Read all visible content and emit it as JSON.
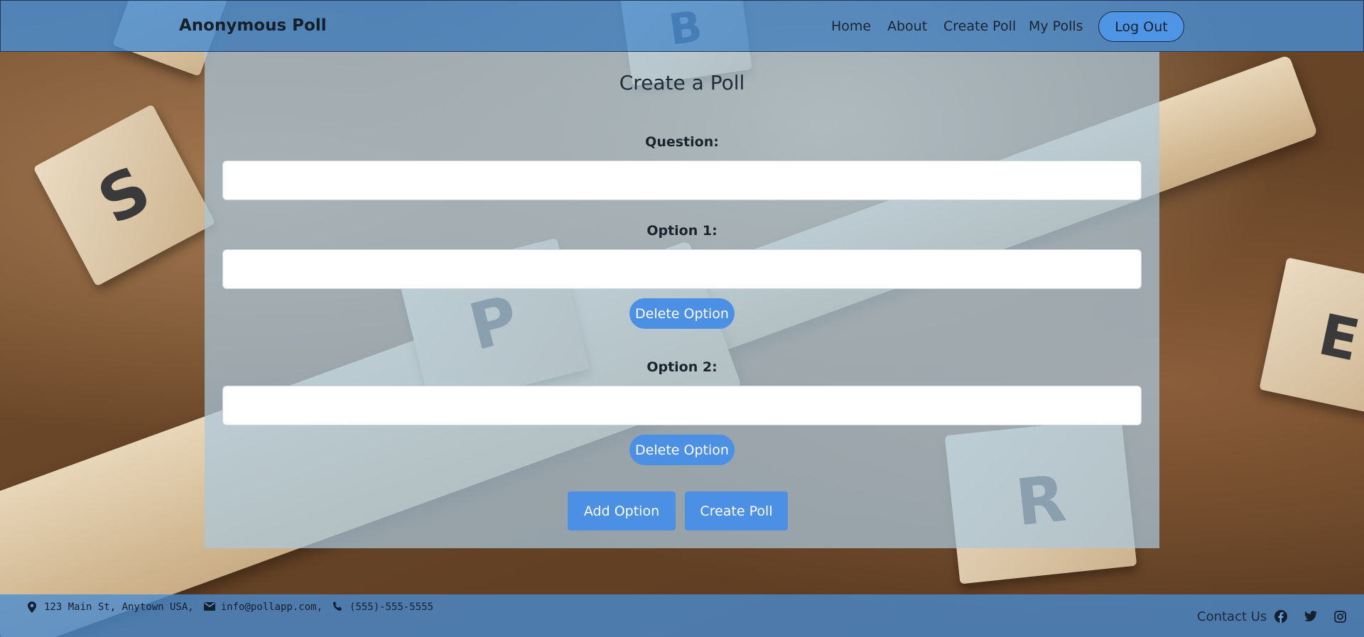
{
  "navbar": {
    "brand": "Anonymous Poll",
    "links": [
      "Home",
      "About",
      "Create Poll",
      "My Polls"
    ],
    "logout_label": "Log Out"
  },
  "form": {
    "title": "Create a Poll",
    "question_label": "Question:",
    "question_value": "",
    "options": [
      {
        "label": "Option 1:",
        "value": "",
        "delete_label": "Delete Option"
      },
      {
        "label": "Option 2:",
        "value": "",
        "delete_label": "Delete Option"
      }
    ],
    "add_option_label": "Add Option",
    "create_poll_label": "Create Poll"
  },
  "footer": {
    "address": "123 Main St, Anytown USA,",
    "email": "info@pollapp.com,",
    "phone": "(555)-555-5555",
    "contact_label": "Contact Us",
    "social_icons": [
      "facebook-icon",
      "twitter-icon",
      "instagram-icon"
    ]
  },
  "colors": {
    "navbar": "#488cd2",
    "button": "#4b90e4",
    "panel": "#aac8dc"
  }
}
